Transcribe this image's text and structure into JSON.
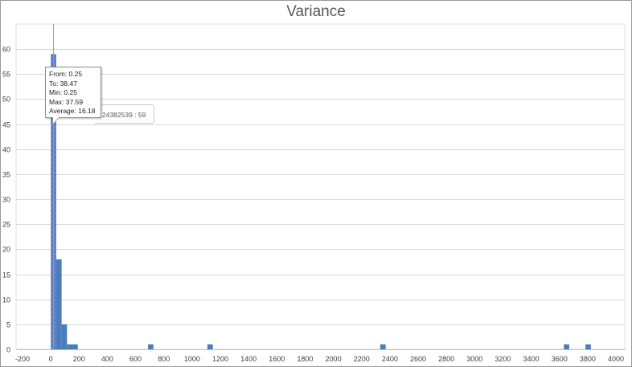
{
  "chart_data": {
    "type": "bar",
    "title": "Variance",
    "xlabel": "",
    "ylabel": "",
    "xlim": [
      -200,
      4000
    ],
    "ylim": [
      0,
      65
    ],
    "x_ticks": [
      -200,
      0,
      200,
      400,
      600,
      800,
      1000,
      1200,
      1400,
      1600,
      1800,
      2000,
      2200,
      2400,
      2600,
      2800,
      3000,
      3200,
      3400,
      3600,
      3800,
      4000
    ],
    "y_ticks": [
      0,
      5,
      10,
      15,
      20,
      25,
      30,
      35,
      40,
      45,
      50,
      55,
      60
    ],
    "grid": "horizontal",
    "bar_color": "#4a7ebb",
    "highlight_line_color": "#e070d0",
    "bins": [
      {
        "from": 0.25,
        "to": 38.47,
        "count": 59,
        "highlighted": true
      },
      {
        "from": 38.47,
        "to": 76.69,
        "count": 18
      },
      {
        "from": 76.69,
        "to": 114.91,
        "count": 5
      },
      {
        "from": 114.91,
        "to": 153.13,
        "count": 1
      },
      {
        "from": 153.13,
        "to": 191.35,
        "count": 1
      },
      {
        "from": 688.43,
        "to": 726.65,
        "count": 1
      },
      {
        "from": 1108.85,
        "to": 1147.07,
        "count": 1
      },
      {
        "from": 2331.89,
        "to": 2370.11,
        "count": 1
      },
      {
        "from": 3631.37,
        "to": 3669.59,
        "count": 1
      },
      {
        "from": 3784.25,
        "to": 3822.47,
        "count": 1
      }
    ],
    "highlight_x": 19.36
  },
  "tooltip": {
    "from": "From: 0.25",
    "to": "To: 38.47",
    "min": "Min: 0.25",
    "max": "Max: 37.59",
    "average": "Average: 16.18"
  },
  "hover_label": "24382539 : 59"
}
